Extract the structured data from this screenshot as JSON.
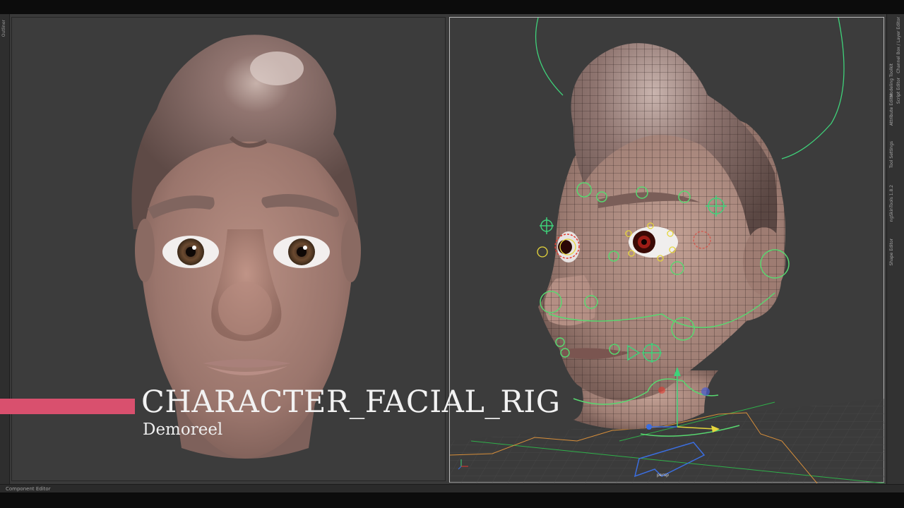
{
  "left_dock": {
    "tab_label": "Outliner"
  },
  "right_dock": {
    "tabs": [
      "Modeling Toolkit",
      "Attribute Editor",
      "Tool Settings",
      "ngSkinTools 1.8.2",
      "Shape Editor"
    ],
    "tabs_outer": [
      "Channel Box / Layer Editor",
      "Script Editor"
    ]
  },
  "viewport_right": {
    "camera_label": "persp"
  },
  "status_bar": {
    "label": "Component Editor"
  },
  "overlay": {
    "title": "CHARACTER_FACIAL_RIG",
    "subtitle": "Demoreel",
    "accent_color": "#d9506e"
  }
}
